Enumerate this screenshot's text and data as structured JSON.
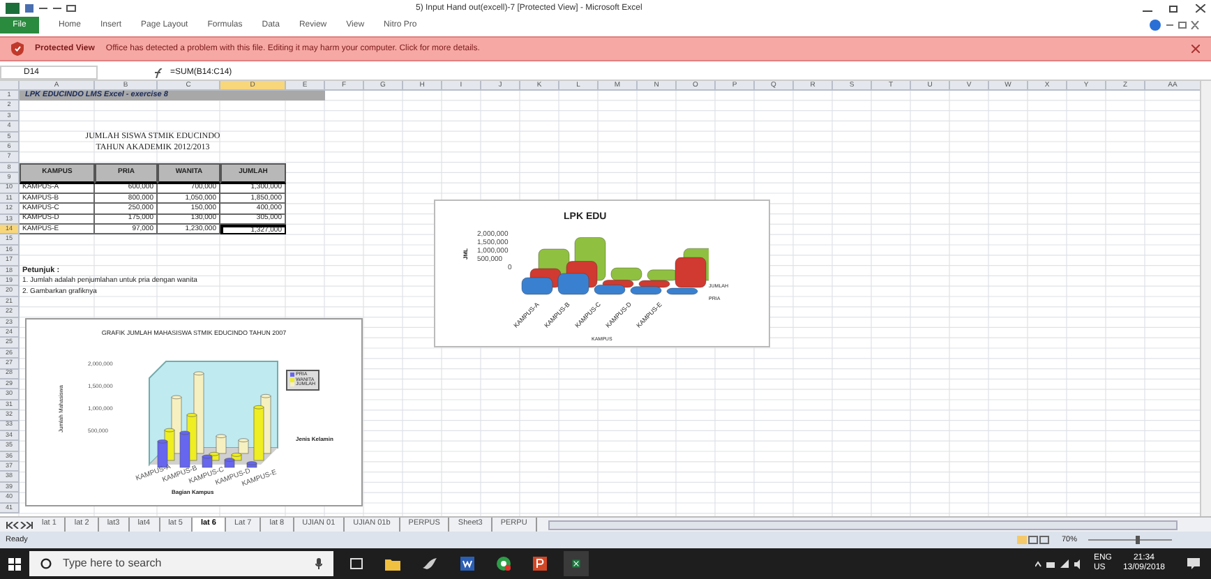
{
  "window": {
    "title": "5) Input Hand out(excell)-7 [Protected View] - Microsoft Excel"
  },
  "ribbon_tabs": [
    {
      "label": "File",
      "kind": "file"
    },
    {
      "label": "Home",
      "kind": "tab"
    },
    {
      "label": "Insert",
      "kind": "tab"
    },
    {
      "label": "Page Layout",
      "kind": "tab"
    },
    {
      "label": "Formulas",
      "kind": "tab"
    },
    {
      "label": "Data",
      "kind": "tab"
    },
    {
      "label": "Review",
      "kind": "tab"
    },
    {
      "label": "View",
      "kind": "tab"
    },
    {
      "label": "Nitro Pro",
      "kind": "tab"
    }
  ],
  "protected_view": {
    "label": "Protected View",
    "message": "Office has detected a problem with this file. Editing it may harm your computer. Click for more details."
  },
  "formula_bar": {
    "name_box": "D14",
    "formula": "=SUM(B14:C14)"
  },
  "columns": [
    {
      "label": "A",
      "selected": false
    },
    {
      "label": "B",
      "selected": false
    },
    {
      "label": "C",
      "selected": false
    },
    {
      "label": "D",
      "selected": true
    },
    {
      "label": "E",
      "selected": false
    },
    {
      "label": "F",
      "selected": false
    },
    {
      "label": "G",
      "selected": false
    },
    {
      "label": "H",
      "selected": false
    },
    {
      "label": "I",
      "selected": false
    },
    {
      "label": "J",
      "selected": false
    },
    {
      "label": "K",
      "selected": false
    },
    {
      "label": "L",
      "selected": false
    },
    {
      "label": "M",
      "selected": false
    },
    {
      "label": "N",
      "selected": false
    },
    {
      "label": "O",
      "selected": false
    },
    {
      "label": "P",
      "selected": false
    },
    {
      "label": "Q",
      "selected": false
    },
    {
      "label": "R",
      "selected": false
    },
    {
      "label": "S",
      "selected": false
    },
    {
      "label": "T",
      "selected": false
    },
    {
      "label": "U",
      "selected": false
    },
    {
      "label": "V",
      "selected": false
    },
    {
      "label": "W",
      "selected": false
    },
    {
      "label": "X",
      "selected": false
    },
    {
      "label": "Y",
      "selected": false
    },
    {
      "label": "Z",
      "selected": false
    },
    {
      "label": "AA",
      "selected": false
    }
  ],
  "rows": [
    {
      "label": "1",
      "selected": false
    },
    {
      "label": "2",
      "selected": false
    },
    {
      "label": "3",
      "selected": false
    },
    {
      "label": "4",
      "selected": false
    },
    {
      "label": "5",
      "selected": false
    },
    {
      "label": "6",
      "selected": false
    },
    {
      "label": "7",
      "selected": false
    },
    {
      "label": "8",
      "selected": false
    },
    {
      "label": "9",
      "selected": false
    },
    {
      "label": "10",
      "selected": false
    },
    {
      "label": "11",
      "selected": false
    },
    {
      "label": "12",
      "selected": false
    },
    {
      "label": "13",
      "selected": false
    },
    {
      "label": "14",
      "selected": true
    },
    {
      "label": "15",
      "selected": false
    },
    {
      "label": "16",
      "selected": false
    },
    {
      "label": "17",
      "selected": false
    },
    {
      "label": "18",
      "selected": false
    },
    {
      "label": "19",
      "selected": false
    },
    {
      "label": "20",
      "selected": false
    },
    {
      "label": "21",
      "selected": false
    },
    {
      "label": "22",
      "selected": false
    },
    {
      "label": "23",
      "selected": false
    },
    {
      "label": "24",
      "selected": false
    },
    {
      "label": "25",
      "selected": false
    },
    {
      "label": "26",
      "selected": false
    },
    {
      "label": "27",
      "selected": false
    },
    {
      "label": "28",
      "selected": false
    },
    {
      "label": "29",
      "selected": false
    },
    {
      "label": "30",
      "selected": false
    },
    {
      "label": "31",
      "selected": false
    },
    {
      "label": "32",
      "selected": false
    },
    {
      "label": "33",
      "selected": false
    },
    {
      "label": "34",
      "selected": false
    },
    {
      "label": "35",
      "selected": false
    },
    {
      "label": "36",
      "selected": false
    },
    {
      "label": "37",
      "selected": false
    },
    {
      "label": "38",
      "selected": false
    },
    {
      "label": "39",
      "selected": false
    },
    {
      "label": "40",
      "selected": false
    },
    {
      "label": "41",
      "selected": false
    }
  ],
  "banner": "LPK EDUCINDO LMS Excel - exercise 8",
  "heading": [
    "JUMLAH SISWA STMIK EDUCINDO",
    "TAHUN AKADEMIK 2012/2013"
  ],
  "table": {
    "columns": [
      "KAMPUS",
      "PRIA",
      "WANITA",
      "JUMLAH"
    ],
    "rows": [
      {
        "cells": [
          "KAMPUS-A",
          "600,000",
          "700,000",
          "1,300,000"
        ],
        "active": false
      },
      {
        "cells": [
          "KAMPUS-B",
          "800,000",
          "1,050,000",
          "1,850,000"
        ],
        "active": false
      },
      {
        "cells": [
          "KAMPUS-C",
          "250,000",
          "150,000",
          "400,000"
        ],
        "active": false
      },
      {
        "cells": [
          "KAMPUS-D",
          "175,000",
          "130,000",
          "305,000"
        ],
        "active": false
      },
      {
        "cells": [
          "KAMPUS-E",
          "97,000",
          "1,230,000",
          "1,327,000"
        ],
        "active": true
      }
    ]
  },
  "notes": {
    "title": "Petunjuk :",
    "items": [
      "1. Jumlah adalah penjumlahan untuk pria dengan wanita",
      "2. Gambarkan grafiknya"
    ]
  },
  "chart_1": {
    "title": "GRAFIK JUMLAH MAHASISWA STMIK EDUCINDO TAHUN 2007",
    "yticks": [
      "2,000,000",
      "1,500,000",
      "1,000,000",
      "500,000"
    ],
    "ylabel": "Jumlah Mahasiswa",
    "xlabel": "Bagian Kampus",
    "zlabel": "Jenis Kelamin",
    "categories": [
      "KAMPUS-A",
      "KAMPUS-B",
      "KAMPUS-C",
      "KAMPUS-D",
      "KAMPUS-E"
    ],
    "legend": [
      {
        "label": "PRIA",
        "color": "#6666ee"
      },
      {
        "label": "WANITA",
        "color": "#eeee22"
      },
      {
        "label": "JUMLAH",
        "color": "#f6f0c0"
      }
    ]
  },
  "chart_2": {
    "title": "LPK EDU",
    "yticks": [
      "2,000,000",
      "1,500,000",
      "1,000,000",
      "500,000",
      "0"
    ],
    "ylabel": "JML",
    "xlabel": "KAMPUS",
    "categories": [
      "KAMPUS-A",
      "KAMPUS-B",
      "KAMPUS-C",
      "KAMPUS-D",
      "KAMPUS-E"
    ],
    "series_labels": [
      "JUMLAH",
      "PRIA"
    ]
  },
  "sheet_tabs": [
    {
      "label": "lat 1",
      "selected": false
    },
    {
      "label": "lat 2",
      "selected": false
    },
    {
      "label": "lat3",
      "selected": false
    },
    {
      "label": "lat4",
      "selected": false
    },
    {
      "label": "lat 5",
      "selected": false
    },
    {
      "label": "lat 6",
      "selected": true
    },
    {
      "label": "Lat 7",
      "selected": false
    },
    {
      "label": "lat 8",
      "selected": false
    },
    {
      "label": "UJIAN 01",
      "selected": false
    },
    {
      "label": "UJIAN 01b",
      "selected": false
    },
    {
      "label": "PERPUS",
      "selected": false
    },
    {
      "label": "Sheet3",
      "selected": false
    },
    {
      "label": "PERPU",
      "selected": false
    }
  ],
  "status_bar": {
    "status": "Ready",
    "zoom": "70%"
  },
  "taskbar": {
    "search_placeholder": "Type here to search",
    "language": "ENG",
    "region": "US",
    "time": "21:34",
    "date": "13/09/2018"
  }
}
